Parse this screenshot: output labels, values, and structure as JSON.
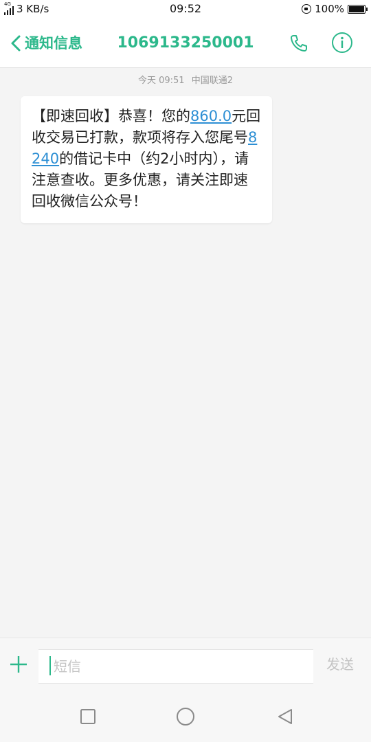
{
  "status_bar": {
    "network": "4G",
    "speed": "3 KB/s",
    "time": "09:52",
    "battery": "100%",
    "battery_level": 1.0
  },
  "header": {
    "back_label": "通知信息",
    "contact": "1069133250001",
    "call_icon": "phone-icon",
    "info_icon": "info-icon"
  },
  "message": {
    "date": "今天 09:51",
    "carrier": "中国联通2",
    "parts": {
      "p1": "【即速回收】恭喜！您的",
      "amount": "860.0",
      "p2": "元回收交易已打款，款项将存入您尾号",
      "card": "8240",
      "p3": "的借记卡中（约2小时内），请注意查收。更多优惠，请关注即速回收微信公众号！"
    }
  },
  "composer": {
    "placeholder": "短信",
    "send_label": "发送",
    "plus_icon": "plus-icon"
  },
  "nav": {
    "recent_icon": "square-icon",
    "home_icon": "circle-icon",
    "back_icon": "triangle-back-icon"
  },
  "colors": {
    "accent": "#2cb88b",
    "link": "#2d8fd4",
    "background": "#f4f4f4"
  }
}
